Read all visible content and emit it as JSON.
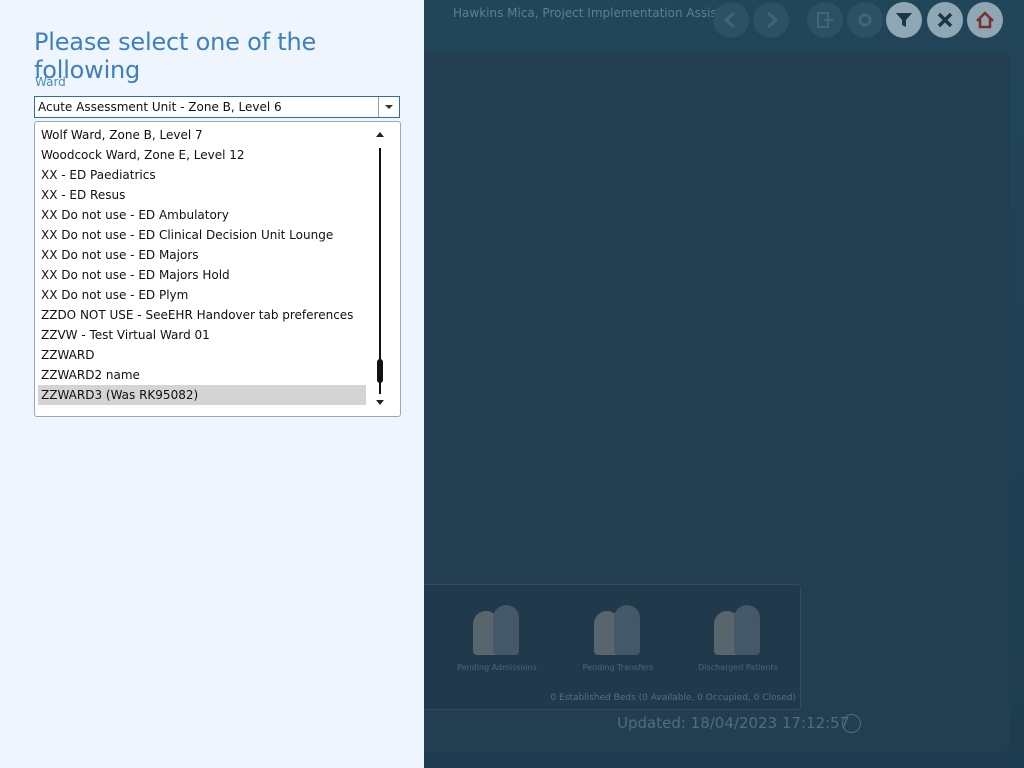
{
  "background": {
    "header_user": "Hawkins Mica, Project Implementation Assistant",
    "toolbar_icons": [
      "back-icon",
      "forward-icon",
      "logout-icon",
      "settings-icon",
      "filter-icon",
      "close-icon",
      "home-icon"
    ],
    "cards": [
      {
        "label": "Pending Admissions"
      },
      {
        "label": "Pending Transfers"
      },
      {
        "label": "Discharged Patients"
      }
    ],
    "beds_summary": "0 Established Beds (0 Available, 0 Occupied, 0 Closed)",
    "updated": "Updated: 18/04/2023 17:12:57"
  },
  "panel": {
    "title": "Please select one of the following",
    "ward_label": "Ward",
    "ward_value": "Acute Assessment Unit - Zone B, Level 6",
    "ward_options": [
      "Wolf Ward, Zone B, Level 7",
      "Woodcock Ward, Zone E, Level 12",
      "XX - ED Paediatrics",
      "XX - ED Resus",
      "XX Do not use - ED Ambulatory",
      "XX Do not use - ED Clinical Decision Unit Lounge",
      "XX Do not use - ED Majors",
      "XX Do not use - ED Majors Hold",
      "XX Do not use - ED Plym",
      "ZZDO NOT USE - SeeEHR Handover tab preferences",
      "ZZVW - Test Virtual Ward 01",
      "ZZWARD",
      "ZZWARD2 name",
      "ZZWARD3 (Was RK95082)"
    ],
    "highlighted_option": "ZZWARD3 (Was RK95082)",
    "list_scroll_position": 0.95
  },
  "colors": {
    "panel_bg": "#eef5fd",
    "accent": "#3e80bf",
    "highlight": "#d4d4d4",
    "overlay_bg": "#1f3a4d"
  }
}
